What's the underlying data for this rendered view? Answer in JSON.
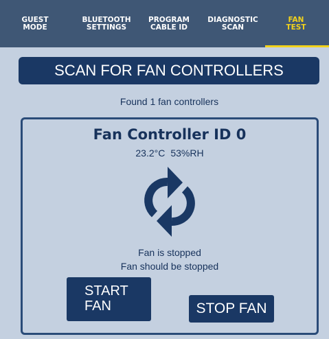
{
  "tabs": [
    {
      "line1": "GUEST",
      "line2": "MODE"
    },
    {
      "line1": "BLUETOOTH",
      "line2": "SETTINGS"
    },
    {
      "line1": "PROGRAM",
      "line2": "CABLE ID"
    },
    {
      "line1": "DIAGNOSTIC",
      "line2": "SCAN"
    },
    {
      "line1": "FAN",
      "line2": "TEST",
      "active": true
    }
  ],
  "scan_button_label": "SCAN FOR FAN CONTROLLERS",
  "found_text": "Found 1 fan controllers",
  "controller": {
    "title": "Fan Controller ID 0",
    "temperature": "23.2°C",
    "humidity": "53%RH",
    "icon": "refresh-icon",
    "status_actual": "Fan is stopped",
    "status_expected": "Fan should be stopped",
    "start_label": "START FAN",
    "stop_label": "STOP FAN"
  },
  "colors": {
    "background": "#c4d0e0",
    "tabbar": "#3f5775",
    "active_tab": "#f2d21b",
    "primary": "#1a3864"
  }
}
